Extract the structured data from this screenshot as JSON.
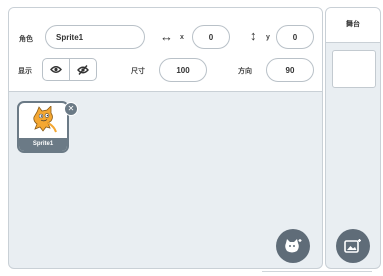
{
  "sprite_info": {
    "sprite_label": "角色",
    "sprite_name": "Sprite1",
    "x_label": "x",
    "x_value": "0",
    "y_label": "y",
    "y_value": "0",
    "show_label": "显示",
    "size_label": "尺寸",
    "size_value": "100",
    "direction_label": "方向",
    "direction_value": "90"
  },
  "sprites": [
    {
      "name": "Sprite1",
      "selected": true
    }
  ],
  "stage": {
    "label": "舞台"
  },
  "buttons": {
    "choose_sprite_icon": "cat-plus-icon",
    "choose_backdrop_icon": "image-plus-icon",
    "delete_icon": "close-icon"
  },
  "colors": {
    "pane_bg": "#e9eef2",
    "selected_border": "#6b7a86",
    "fab": "#5f6c78"
  }
}
